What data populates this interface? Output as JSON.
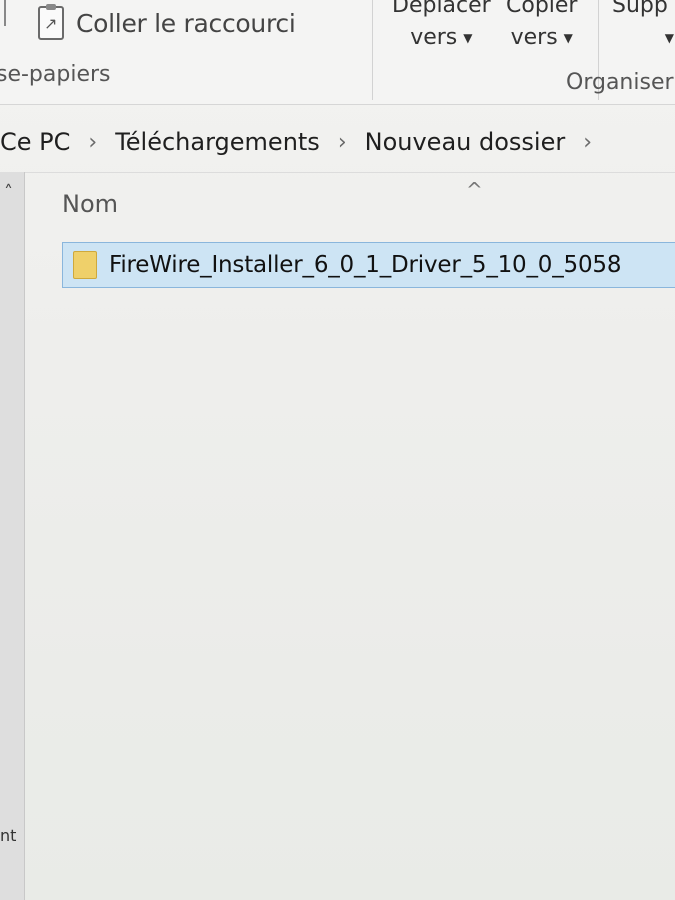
{
  "ribbon": {
    "paste_shortcut_label": "Coller le raccourci",
    "clipboard_group_label": "se-papiers",
    "move_to_line1": "Déplacer",
    "move_to_line2": "vers",
    "copy_to_line1": "Copier",
    "copy_to_line2": "vers",
    "delete_label": "Supp",
    "organize_group_label": "Organiser"
  },
  "address": {
    "crumbs": [
      "Ce PC",
      "Téléchargements",
      "Nouveau dossier"
    ]
  },
  "list": {
    "column_name": "Nom",
    "files": [
      {
        "name": "FireWire_Installer_6_0_1_Driver_5_10_0_5058",
        "type": "folder"
      }
    ]
  },
  "left_pane": {
    "fragment_text": "nt"
  },
  "colors": {
    "selection": "#cde4f4",
    "selection_border": "#8ab6dc",
    "folder": "#efd06a"
  }
}
